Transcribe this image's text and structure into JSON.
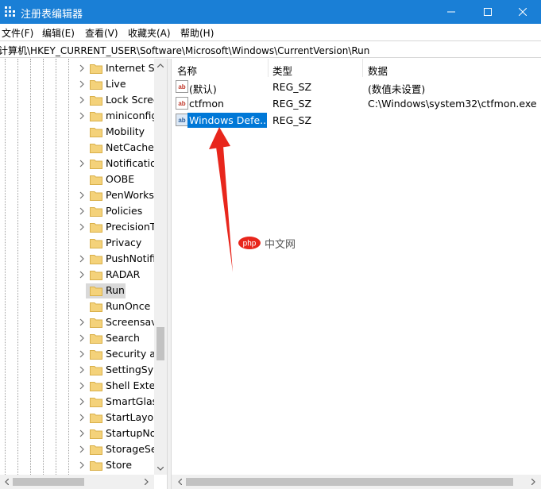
{
  "window": {
    "title": "注册表编辑器"
  },
  "menu": [
    {
      "label": "文件(F)"
    },
    {
      "label": "编辑(E)"
    },
    {
      "label": "查看(V)"
    },
    {
      "label": "收藏夹(A)"
    },
    {
      "label": "帮助(H)"
    }
  ],
  "address": "计算机\\HKEY_CURRENT_USER\\Software\\Microsoft\\Windows\\CurrentVersion\\Run",
  "tree": {
    "items": [
      {
        "label": "Internet Se",
        "expandable": true
      },
      {
        "label": "Live",
        "expandable": true
      },
      {
        "label": "Lock Scree",
        "expandable": true
      },
      {
        "label": "miniconfig",
        "expandable": true
      },
      {
        "label": "Mobility",
        "expandable": false
      },
      {
        "label": "NetCache",
        "expandable": false
      },
      {
        "label": "Notificatio",
        "expandable": true
      },
      {
        "label": "OOBE",
        "expandable": false
      },
      {
        "label": "PenWorks",
        "expandable": true
      },
      {
        "label": "Policies",
        "expandable": true
      },
      {
        "label": "PrecisionT",
        "expandable": true
      },
      {
        "label": "Privacy",
        "expandable": false
      },
      {
        "label": "PushNotifi",
        "expandable": true
      },
      {
        "label": "RADAR",
        "expandable": true
      },
      {
        "label": "Run",
        "expandable": false,
        "selected": true
      },
      {
        "label": "RunOnce",
        "expandable": false
      },
      {
        "label": "Screensave",
        "expandable": true
      },
      {
        "label": "Search",
        "expandable": true
      },
      {
        "label": "Security ar",
        "expandable": true
      },
      {
        "label": "SettingSyn",
        "expandable": true
      },
      {
        "label": "Shell Exter",
        "expandable": true
      },
      {
        "label": "SmartGlas",
        "expandable": true
      },
      {
        "label": "StartLayou",
        "expandable": true
      },
      {
        "label": "StartupNo",
        "expandable": true
      },
      {
        "label": "StorageSe",
        "expandable": true
      },
      {
        "label": "Store",
        "expandable": true
      }
    ]
  },
  "list": {
    "columns": {
      "name": "名称",
      "type": "类型",
      "data": "数据"
    },
    "rows": [
      {
        "name": "(默认)",
        "type": "REG_SZ",
        "data": "(数值未设置)"
      },
      {
        "name": "ctfmon",
        "type": "REG_SZ",
        "data": "C:\\Windows\\system32\\ctfmon.exe"
      },
      {
        "name": "Windows Defe...",
        "type": "REG_SZ",
        "data": "",
        "selected": true
      }
    ]
  },
  "watermark": {
    "logo": "php",
    "text": "中文网"
  },
  "colors": {
    "titlebar": "#1a7fd6",
    "selection": "#0078d7",
    "arrow": "#e8261c",
    "folder": "#f4d27a"
  }
}
